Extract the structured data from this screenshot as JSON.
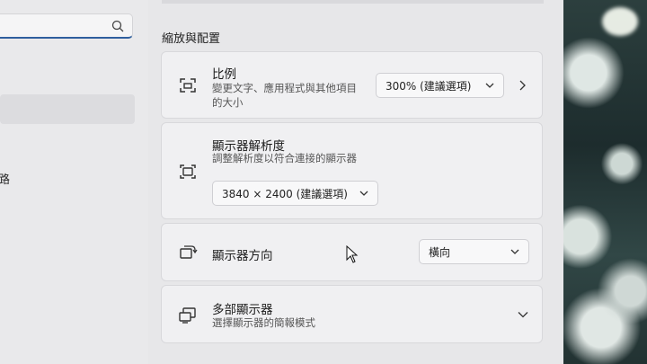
{
  "search": {
    "placeholder": "",
    "value": ""
  },
  "sidebar": {
    "fragment_label": "路"
  },
  "section_title": "縮放與配置",
  "scale": {
    "title": "比例",
    "description": "變更文字、應用程式與其他項目的大小",
    "value": "300% (建議選項)"
  },
  "resolution": {
    "title": "顯示器解析度",
    "description": "調整解析度以符合連接的顯示器",
    "value": "3840 × 2400 (建議選項)"
  },
  "orientation": {
    "title": "顯示器方向",
    "value": "橫向"
  },
  "multiple_displays": {
    "title": "多部顯示器",
    "description": "選擇顯示器的簡報模式"
  },
  "icons": {
    "search": "search-icon",
    "scale": "scale-icon",
    "resolution": "resolution-icon",
    "orientation": "orientation-icon",
    "multiple_displays": "multiple-displays-icon",
    "cursor": "mouse-cursor-icon"
  },
  "colors": {
    "accent": "#2f5f9e"
  }
}
